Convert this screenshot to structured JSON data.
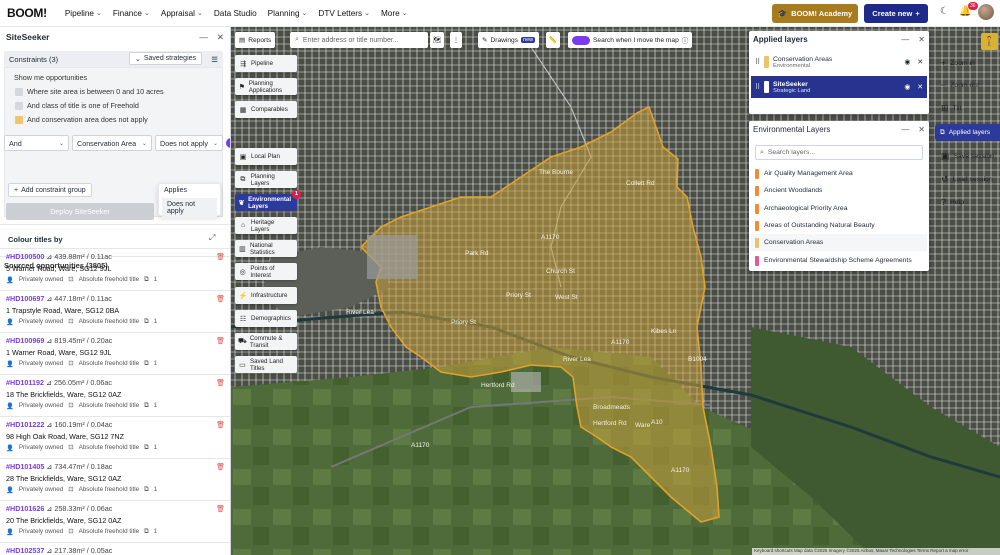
{
  "topbar": {
    "logo": "BOOM!",
    "nav": [
      {
        "label": "Pipeline"
      },
      {
        "label": "Finance"
      },
      {
        "label": "Appraisal"
      },
      {
        "label": "Data Studio"
      },
      {
        "label": "Planning"
      },
      {
        "label": "DTV Letters"
      },
      {
        "label": "More"
      }
    ],
    "academy_label": "BOOM! Academy",
    "create_label": "Create new",
    "notification_count": "36",
    "accent": "#a67c1e",
    "primary": "#1e2a8a"
  },
  "sidebar": {
    "title": "SiteSeeker",
    "constraints_label": "Constraints (3)",
    "saved_strategies": "Saved strategies",
    "show_me": "Show me opportunities",
    "conditions": [
      "Where site area is between 0 and 10 acres",
      "And class of title is one of Freehold",
      "And conservation area does not apply"
    ],
    "dropdowns": {
      "connector": "And",
      "layer": "Conservation Area",
      "operator": "Does not apply"
    },
    "operator_options": [
      "Applies",
      "Does not apply"
    ],
    "add_group": "Add constraint group",
    "deploy": "Deploy SiteSeeker",
    "colour_titles": "Colour titles by",
    "sourced": "Sourced opportunities (3805)",
    "opportunities": [
      {
        "id": "#HD100500",
        "area": "439.88m² / 0.11ac",
        "address": "5 Warner Road, Ware, SG12 9JL",
        "owner": "Privately owned",
        "title": "Absolute freehold title",
        "count": "1"
      },
      {
        "id": "#HD100697",
        "area": "447.18m² / 0.11ac",
        "address": "1 Trapstyle Road, Ware, SG12 0BA",
        "owner": "Privately owned",
        "title": "Absolute freehold title",
        "count": "1"
      },
      {
        "id": "#HD100969",
        "area": "819.45m² / 0.20ac",
        "address": "1 Warner Road, Ware, SG12 9JL",
        "owner": "Privately owned",
        "title": "Absolute freehold title",
        "count": "1"
      },
      {
        "id": "#HD101192",
        "area": "256.05m² / 0.06ac",
        "address": "18 The Brickfields, Ware, SG12 0AZ",
        "owner": "Privately owned",
        "title": "Absolute freehold title",
        "count": "1"
      },
      {
        "id": "#HD101222",
        "area": "160.19m² / 0.04ac",
        "address": "98 High Oak Road, Ware, SG12 7NZ",
        "owner": "Privately owned",
        "title": "Absolute freehold title",
        "count": "1"
      },
      {
        "id": "#HD101405",
        "area": "734.47m² / 0.18ac",
        "address": "28 The Brickfields, Ware, SG12 0AZ",
        "owner": "Privately owned",
        "title": "Absolute freehold title",
        "count": "1"
      },
      {
        "id": "#HD101626",
        "area": "258.33m² / 0.06ac",
        "address": "20 The Brickfields, Ware, SG12 0AZ",
        "owner": "Privately owned",
        "title": "Absolute freehold title",
        "count": "1"
      },
      {
        "id": "#HD102537",
        "area": "217.38m² / 0.05ac",
        "address": "",
        "owner": "",
        "title": "",
        "count": ""
      }
    ]
  },
  "map": {
    "search_placeholder": "Enter address or title number...",
    "reports": "Reports",
    "drawings": "Drawings",
    "drawings_badge": "new",
    "search_when_move": "Search when I move the map",
    "layer_buttons": [
      {
        "label": "Pipeline",
        "icon": "pipeline-icon"
      },
      {
        "label": "Planning Applications",
        "icon": "planning-icon"
      },
      {
        "label": "Comparables",
        "icon": "comparables-icon"
      },
      {
        "label": "Local Plan",
        "icon": "local-plan-icon"
      },
      {
        "label": "Planning Layers",
        "icon": "layers-icon"
      },
      {
        "label": "Environmental Layers",
        "icon": "leaf-icon",
        "badge": "1"
      },
      {
        "label": "Heritage Layers",
        "icon": "heritage-icon"
      },
      {
        "label": "National Statistics",
        "icon": "stats-icon"
      },
      {
        "label": "Points of Interest",
        "icon": "poi-icon"
      },
      {
        "label": "Infrastructure",
        "icon": "infrastructure-icon"
      },
      {
        "label": "Demographics",
        "icon": "demographics-icon"
      },
      {
        "label": "Commute & Transit",
        "icon": "car-icon"
      },
      {
        "label": "Saved Land Titles",
        "icon": "saved-icon"
      }
    ],
    "street_labels": [
      "The Bourne",
      "Collett Rd",
      "Park Rd",
      "Priory St",
      "Priory St",
      "West St",
      "Church St",
      "Kibes Ln",
      "River Lea",
      "River Lea",
      "B1004",
      "A1170",
      "A1170",
      "A1170",
      "A10",
      "Hertford Rd",
      "Hertford Rd",
      "Broadmeads",
      "Ware",
      "A1170"
    ],
    "attribution": "Keyboard shortcuts  Map data ©2025 Imagery ©2025 Airbus, Maxar Technologies  Terms  Report a map error"
  },
  "applied_layers": {
    "title": "Applied layers",
    "items": [
      {
        "name": "Conservation Areas",
        "group": "Environmental",
        "color": "#e9c46a"
      },
      {
        "name": "SiteSeeker",
        "group": "Strategic Land",
        "color": "#26338f"
      }
    ]
  },
  "environmental_layers": {
    "title": "Environmental Layers",
    "search_placeholder": "Search layers...",
    "items": [
      {
        "name": "Air Quality Management Area",
        "color": "#f28c38"
      },
      {
        "name": "Ancient Woodlands",
        "color": "#f28c38"
      },
      {
        "name": "Archaeological Priority Area",
        "color": "#f28c38"
      },
      {
        "name": "Areas of Outstanding Natural Beauty",
        "color": "#f28c38"
      },
      {
        "name": "Conservation Areas",
        "color": "#e9c46a"
      },
      {
        "name": "Environmental Stewardship Scheme Agreements",
        "color": "#e05a9c"
      }
    ]
  },
  "right_toolbar": {
    "zoom_in": "Zoom in",
    "zoom_out": "Zoom out",
    "tilt": "Tilt",
    "applied": "Applied layers",
    "save_session": "Save session",
    "load_session": "Load session",
    "help": "Help"
  }
}
